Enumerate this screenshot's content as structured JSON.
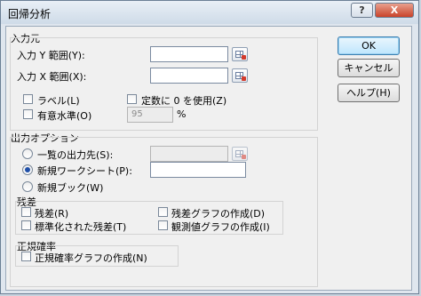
{
  "dialog": {
    "title": "回帰分析",
    "help_glyph": "?",
    "close_glyph": "X"
  },
  "input_section": {
    "title": "入力元",
    "y_range_label": "入力 Y 範囲(Y):",
    "x_range_label": "入力 X 範囲(X):",
    "y_range_value": "",
    "x_range_value": "",
    "labels_label": "ラベル(L)",
    "constant_zero_label": "定数に 0 を使用(Z)",
    "confidence_label": "有意水準(O)",
    "confidence_value": "95",
    "confidence_unit": "%"
  },
  "output_section": {
    "title": "出力オプション",
    "output_range_label": "一覧の出力先(S):",
    "new_sheet_label": "新規ワークシート(P):",
    "new_workbook_label": "新規ブック(W)",
    "output_range_value": "",
    "new_sheet_value": "",
    "selected": "new_sheet"
  },
  "residuals_section": {
    "title": "残差",
    "residuals_label": "残差(R)",
    "standardized_label": "標準化された残差(T)",
    "residual_plots_label": "残差グラフの作成(D)",
    "line_fit_label": "観測値グラフの作成(I)"
  },
  "normal_section": {
    "title": "正規確率",
    "normal_plot_label": "正規確率グラフの作成(N)"
  },
  "buttons": {
    "ok": "OK",
    "cancel": "キャンセル",
    "help": "ヘルプ(H)"
  },
  "colors": {
    "accent_radio": "#1f4fa8",
    "close_button": "#c9432a",
    "range_icon_red": "#d23a2c"
  },
  "icons": {
    "range_selector": "range-selector-icon"
  }
}
